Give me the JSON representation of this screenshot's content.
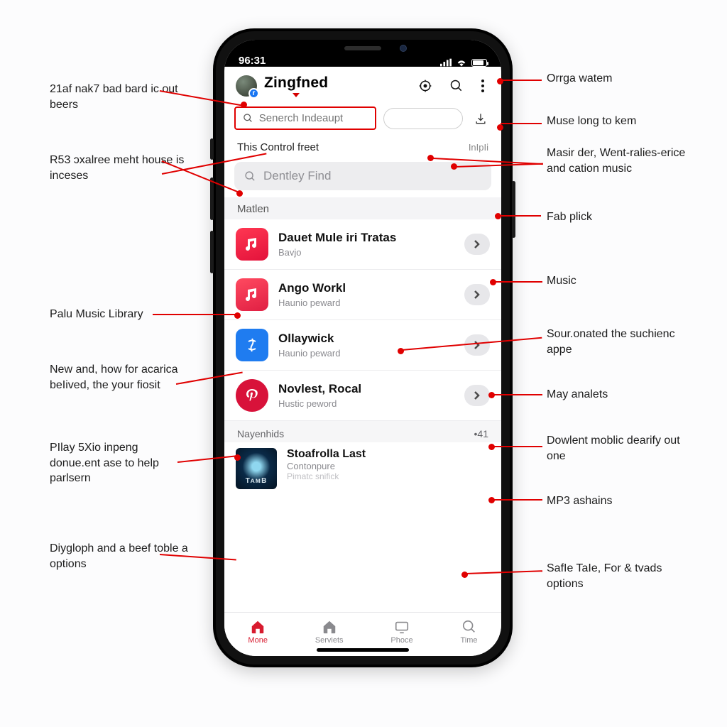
{
  "status": {
    "time": "96:31"
  },
  "header": {
    "avatar_badge": "r",
    "title": "Zingfned"
  },
  "search_outline_placeholder": "Senerch Indeaupt",
  "section1": {
    "title": "This Control freet",
    "meta": "InIpIi"
  },
  "gray_search_placeholder": "Dentley Find",
  "group_title": "Matlen",
  "items": [
    {
      "title": "Dauet Mule iri Tratas",
      "sub": "Bavjo"
    },
    {
      "title": "Ango Workl",
      "sub": "Haunio peward"
    },
    {
      "title": "Ollaywick",
      "sub": "Haunio peward"
    },
    {
      "title": "Novlest, Rocal",
      "sub": "Hustic peword"
    }
  ],
  "playlists": {
    "header": "Nayenhids",
    "meta": "•41",
    "card": {
      "title": "Stoafrolla Last",
      "sub": "Contonpure",
      "sub2": "Pimatc snifick"
    }
  },
  "tabs": [
    {
      "label": "Mone"
    },
    {
      "label": "Serviets"
    },
    {
      "label": "Phoce"
    },
    {
      "label": "Time"
    }
  ],
  "annotations_left": [
    "21af nak7 bad bard ic out beers",
    "R53 ɔxalree meht house is inceses",
    "Palu Music Library",
    "New and, how for acarica beIived, the your fiosit",
    "PIlay 5Xio inpeng donue.ent ase to help parlsern",
    "Diygloph and a beef toble a options"
  ],
  "annotations_right": [
    "Orrga watem",
    "Muse long to kem",
    "Masir der, Went-ralies-erice and cation music",
    "Fab plick",
    "Music",
    "Sour.onated the suchienc appe",
    "May analets",
    "Dowlent moblic dearify out one",
    "MP3 ashains",
    "SafIe TaIe, For & tvads options"
  ]
}
